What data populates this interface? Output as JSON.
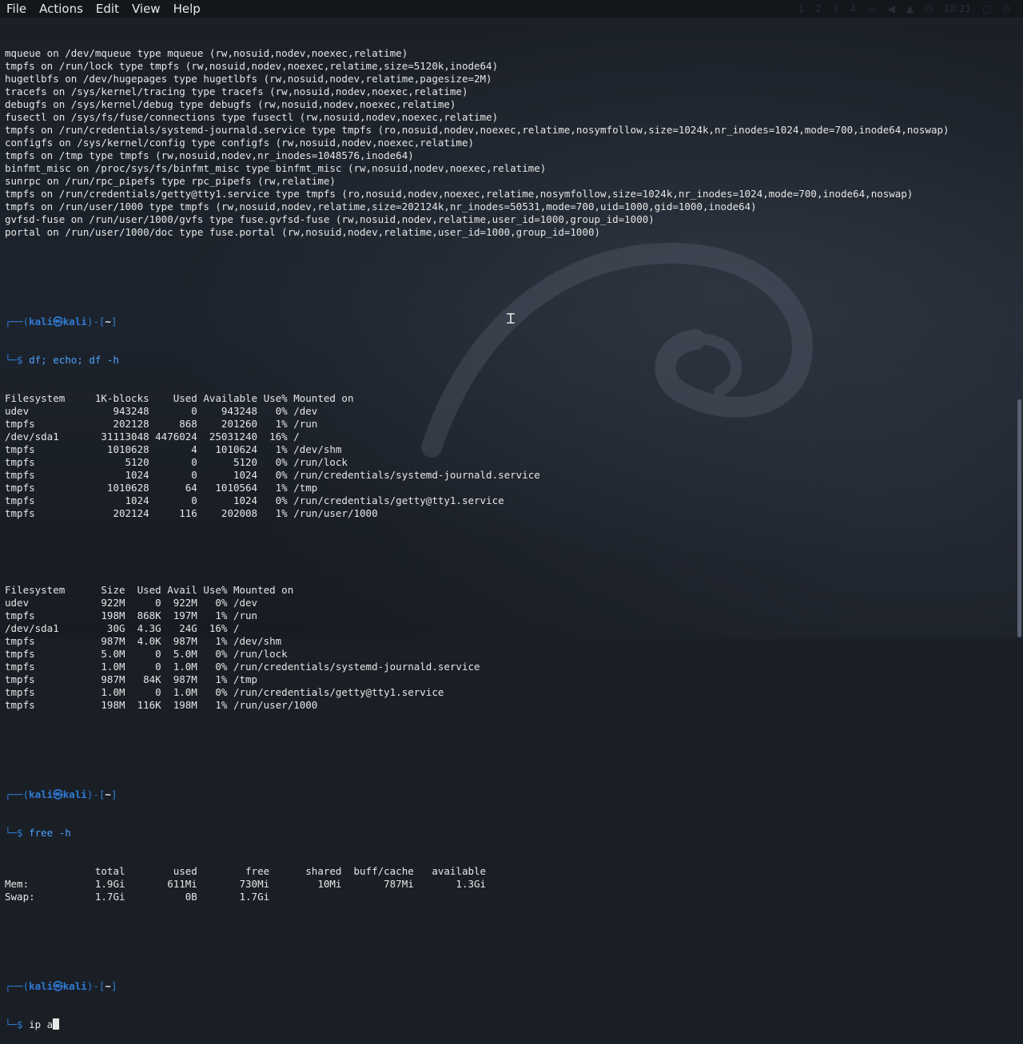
{
  "menubar": {
    "items": [
      "File",
      "Actions",
      "Edit",
      "View",
      "Help"
    ]
  },
  "tray": {
    "workspaces": [
      "1",
      "2",
      "3",
      "4"
    ],
    "clock": "18:21"
  },
  "terminal": {
    "mount_lines": [
      "mqueue on /dev/mqueue type mqueue (rw,nosuid,nodev,noexec,relatime)",
      "tmpfs on /run/lock type tmpfs (rw,nosuid,nodev,noexec,relatime,size=5120k,inode64)",
      "hugetlbfs on /dev/hugepages type hugetlbfs (rw,nosuid,nodev,relatime,pagesize=2M)",
      "tracefs on /sys/kernel/tracing type tracefs (rw,nosuid,nodev,noexec,relatime)",
      "debugfs on /sys/kernel/debug type debugfs (rw,nosuid,nodev,noexec,relatime)",
      "fusectl on /sys/fs/fuse/connections type fusectl (rw,nosuid,nodev,noexec,relatime)",
      "tmpfs on /run/credentials/systemd-journald.service type tmpfs (ro,nosuid,nodev,noexec,relatime,nosymfollow,size=1024k,nr_inodes=1024,mode=700,inode64,noswap)",
      "configfs on /sys/kernel/config type configfs (rw,nosuid,nodev,noexec,relatime)",
      "tmpfs on /tmp type tmpfs (rw,nosuid,nodev,nr_inodes=1048576,inode64)",
      "binfmt_misc on /proc/sys/fs/binfmt_misc type binfmt_misc (rw,nosuid,nodev,noexec,relatime)",
      "sunrpc on /run/rpc_pipefs type rpc_pipefs (rw,relatime)",
      "tmpfs on /run/credentials/getty@tty1.service type tmpfs (ro,nosuid,nodev,noexec,relatime,nosymfollow,size=1024k,nr_inodes=1024,mode=700,inode64,noswap)",
      "tmpfs on /run/user/1000 type tmpfs (rw,nosuid,nodev,relatime,size=202124k,nr_inodes=50531,mode=700,uid=1000,gid=1000,inode64)",
      "gvfsd-fuse on /run/user/1000/gvfs type fuse.gvfsd-fuse (rw,nosuid,nodev,relatime,user_id=1000,group_id=1000)",
      "portal on /run/user/1000/doc type fuse.portal (rw,nosuid,nodev,relatime,user_id=1000,group_id=1000)"
    ],
    "prompt": {
      "user": "kali",
      "at": "㉿",
      "host": "kali",
      "dir": "~"
    },
    "cmd1": "df; echo; df -h",
    "df_lines": [
      "Filesystem     1K-blocks    Used Available Use% Mounted on",
      "udev              943248       0    943248   0% /dev",
      "tmpfs             202128     868    201260   1% /run",
      "/dev/sda1       31113048 4476024  25031240  16% /",
      "tmpfs            1010628       4   1010624   1% /dev/shm",
      "tmpfs               5120       0      5120   0% /run/lock",
      "tmpfs               1024       0      1024   0% /run/credentials/systemd-journald.service",
      "tmpfs            1010628      64   1010564   1% /tmp",
      "tmpfs               1024       0      1024   0% /run/credentials/getty@tty1.service",
      "tmpfs             202124     116    202008   1% /run/user/1000"
    ],
    "dfh_lines": [
      "Filesystem      Size  Used Avail Use% Mounted on",
      "udev            922M     0  922M   0% /dev",
      "tmpfs           198M  868K  197M   1% /run",
      "/dev/sda1        30G  4.3G   24G  16% /",
      "tmpfs           987M  4.0K  987M   1% /dev/shm",
      "tmpfs           5.0M     0  5.0M   0% /run/lock",
      "tmpfs           1.0M     0  1.0M   0% /run/credentials/systemd-journald.service",
      "tmpfs           987M   84K  987M   1% /tmp",
      "tmpfs           1.0M     0  1.0M   0% /run/credentials/getty@tty1.service",
      "tmpfs           198M  116K  198M   1% /run/user/1000"
    ],
    "cmd2": "free -h",
    "free_lines": [
      "               total        used        free      shared  buff/cache   available",
      "Mem:           1.9Gi       611Mi       730Mi        10Mi       787Mi       1.3Gi",
      "Swap:          1.7Gi          0B       1.7Gi"
    ],
    "cmd3_typed": "ip a"
  }
}
